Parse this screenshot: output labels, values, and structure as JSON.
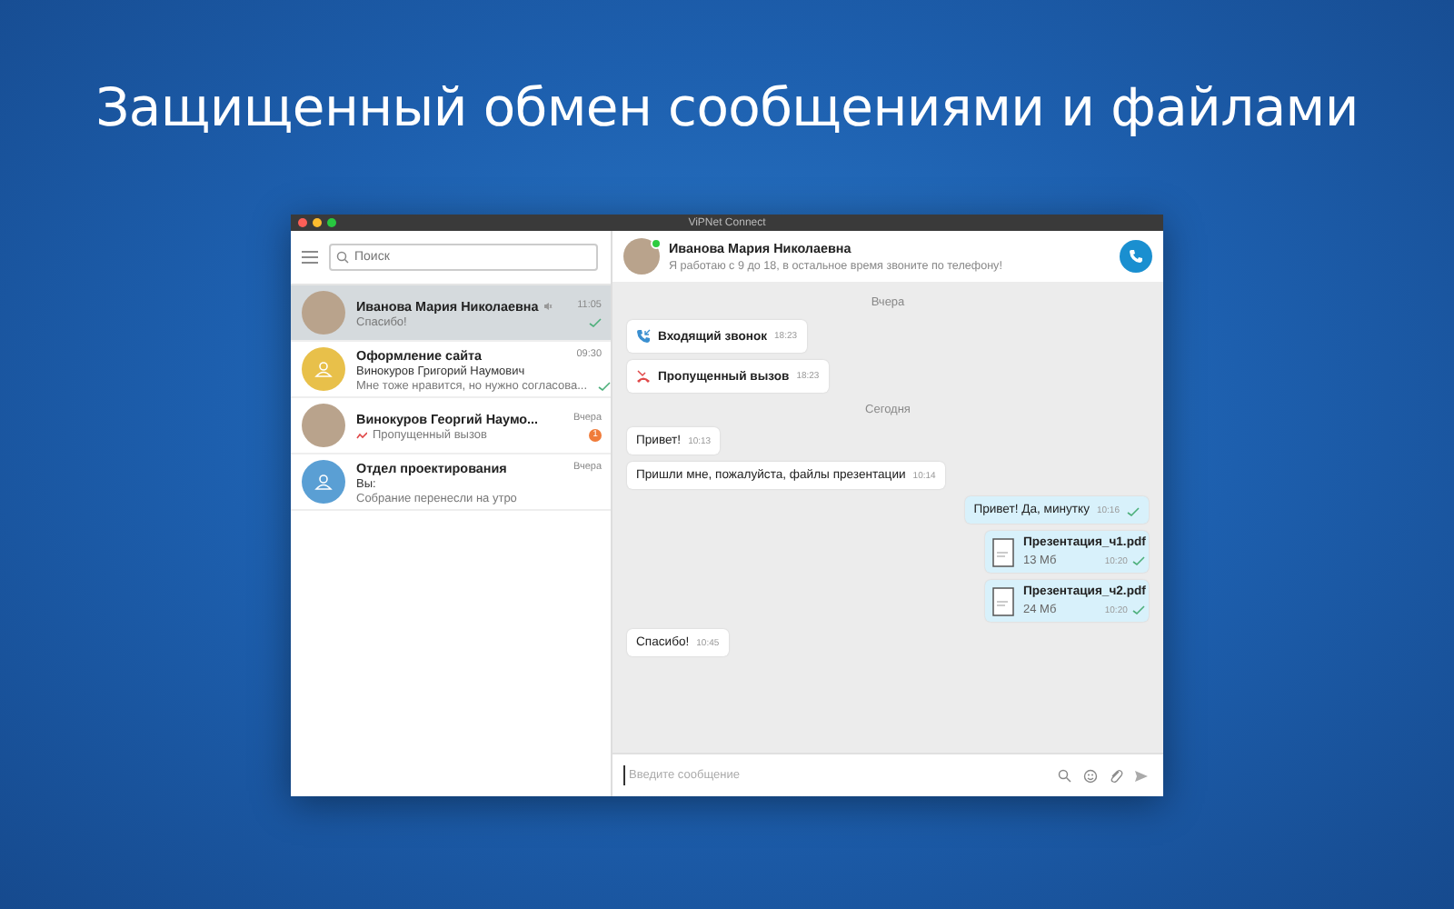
{
  "headline": "Защищенный обмен сообщениями и файлами",
  "window": {
    "title": "ViPNet Connect"
  },
  "sidebar": {
    "search": {
      "placeholder": "Поиск"
    },
    "chats": [
      {
        "name": "Иванова Мария Николаевна",
        "muted": true,
        "time": "11:05",
        "avatar": {
          "kind": "photo"
        },
        "preview": {
          "kind": "text",
          "text": "Спасибо!"
        },
        "read": true,
        "selected": true
      },
      {
        "name": "Оформление сайта",
        "time": "09:30",
        "avatar": {
          "kind": "group",
          "color": "#e8c04a"
        },
        "sender": "Винокуров Григорий Наумович",
        "preview": {
          "kind": "text",
          "text": "Мне тоже нравится, но нужно согласова..."
        },
        "read": true,
        "selected": false
      },
      {
        "name": "Винокуров Георгий Наумо...",
        "time": "Вчера",
        "avatar": {
          "kind": "photo"
        },
        "preview": {
          "kind": "missed_call",
          "text": "Пропущенный вызов"
        },
        "unread": "1",
        "selected": false
      },
      {
        "name": "Отдел проектирования",
        "time": "Вчера",
        "avatar": {
          "kind": "group",
          "color": "#5a9fd4"
        },
        "sender": "Вы:",
        "preview": {
          "kind": "text",
          "text": "Собрание перенесли на утро"
        },
        "selected": false
      }
    ]
  },
  "conversation": {
    "name": "Иванова Мария Николаевна",
    "online": true,
    "status": "Я работаю с 9 до 18, в остальное время звоните по телефону!",
    "messages": [
      {
        "kind": "date",
        "text": "Вчера"
      },
      {
        "kind": "incoming_call",
        "text": "Входящий звонок",
        "time": "18:23",
        "outgoing": false
      },
      {
        "kind": "missed_call",
        "text": "Пропущенный вызов",
        "time": "18:23",
        "outgoing": false
      },
      {
        "kind": "date",
        "text": "Сегодня"
      },
      {
        "kind": "text",
        "text": "Привет!",
        "time": "10:13",
        "outgoing": false
      },
      {
        "kind": "text",
        "text": "Пришли мне, пожалуйста, файлы презентации",
        "time": "10:14",
        "outgoing": false
      },
      {
        "kind": "text",
        "text": "Привет! Да, минутку",
        "time": "10:16",
        "outgoing": true,
        "read": true
      },
      {
        "kind": "file",
        "file_name": "Презентация_ч1.pdf",
        "size": "13 Мб",
        "time": "10:20",
        "outgoing": true,
        "read": true
      },
      {
        "kind": "file",
        "file_name": "Презентация_ч2.pdf",
        "size": "24 Мб",
        "time": "10:20",
        "outgoing": true,
        "read": true
      },
      {
        "kind": "text",
        "text": "Спасибо!",
        "time": "10:45",
        "outgoing": false
      }
    ],
    "composer": {
      "placeholder": "Введите сообщение"
    }
  }
}
